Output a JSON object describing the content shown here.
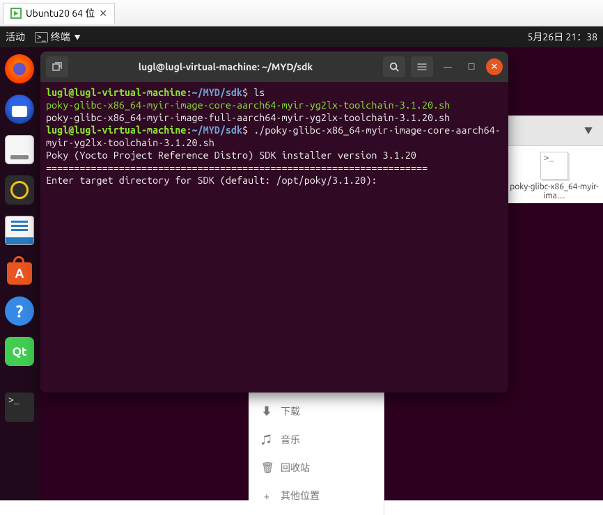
{
  "vm_tab": {
    "label": "Ubuntu20 64 位"
  },
  "topbar": {
    "activities": "活动",
    "app_label": "终端",
    "datetime": "5月26日 21：38"
  },
  "dock": {
    "tooltip_help": "帮助"
  },
  "terminal": {
    "title": "lugl@lugl-virtual-machine: ~/MYD/sdk",
    "prompt_user": "lugl@lugl-virtual-machine",
    "prompt_sep": ":",
    "prompt_path": "~/MYD/sdk",
    "prompt_sym": "$",
    "lines": {
      "cmd1": "ls",
      "out1a": "poky-glibc-x86_64-myir-image-core-aarch64-myir-yg2lx-toolchain-3.1.20.sh",
      "out1b": "poky-glibc-x86_64-myir-image-full-aarch64-myir-yg2lx-toolchain-3.1.20.sh",
      "cmd2": "./poky-glibc-x86_64-myir-image-core-aarch64-myir-yg2lx-toolchain-3.1.20.sh",
      "out2a": "Poky (Yocto Project Reference Distro) SDK installer version 3.1.20",
      "out2b": "====================================================================",
      "out2c": "Enter target directory for SDK (default: /opt/poky/3.1.20): "
    }
  },
  "files": {
    "item_label": "poky-glibc-x86_64-myir-ima…",
    "sidebar": {
      "downloads": "下载",
      "music": "音乐",
      "trash": "回收站",
      "other": "其他位置"
    }
  }
}
